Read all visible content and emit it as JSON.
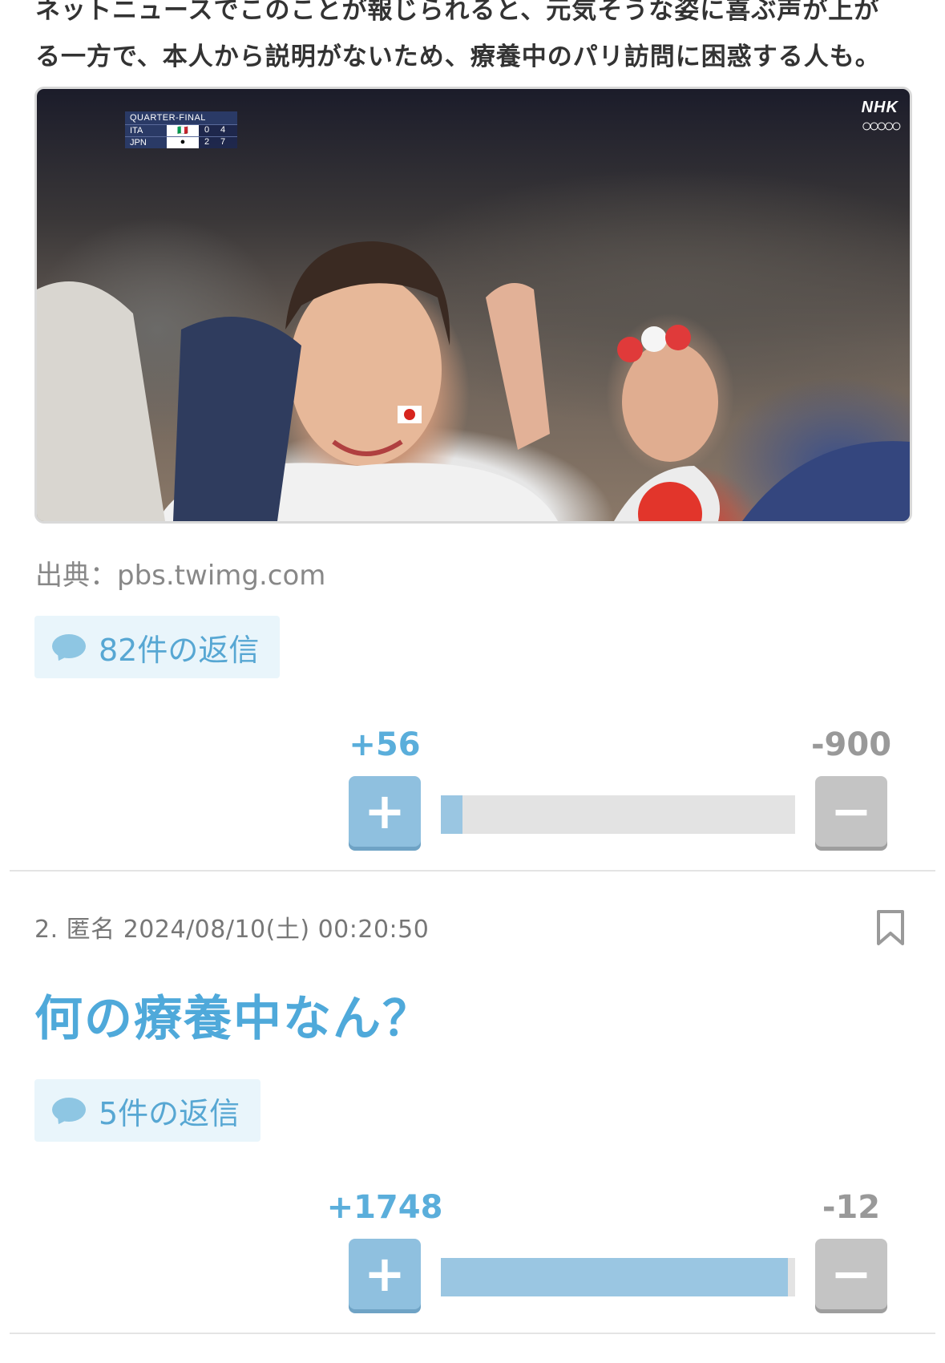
{
  "article": {
    "intro_line_1": "ネットニュースでこのことが報じられると、元気そうな姿に喜ぶ声が上が",
    "intro_line_2": "る一方で、本人から説明がないため、療養中のパリ訪問に困惑する人も。"
  },
  "photo": {
    "scoreboard": {
      "title": "QUARTER-FINAL",
      "teams": [
        {
          "name": "ITA",
          "score_a": "0",
          "score_b": "4"
        },
        {
          "name": "JPN",
          "score_a": "2",
          "score_b": "7"
        }
      ]
    },
    "broadcaster": "NHK"
  },
  "source_label": "出典：pbs.twimg.com",
  "comment_1": {
    "reply_label": "82件の返信",
    "plus": "+56",
    "minus": "-900",
    "plus_ratio": 0.06
  },
  "comment_2": {
    "number": "2.",
    "author": "匿名",
    "timestamp": "2024/08/10(土) 00:20:50",
    "body": "何の療養中なん？",
    "reply_label": "5件の返信",
    "plus": "+1748",
    "minus": "-12",
    "plus_ratio": 0.98
  },
  "colors": {
    "accent_blue": "#4fa9da",
    "plus_button": "#8fc0df",
    "minus_button": "#c4c4c4"
  }
}
